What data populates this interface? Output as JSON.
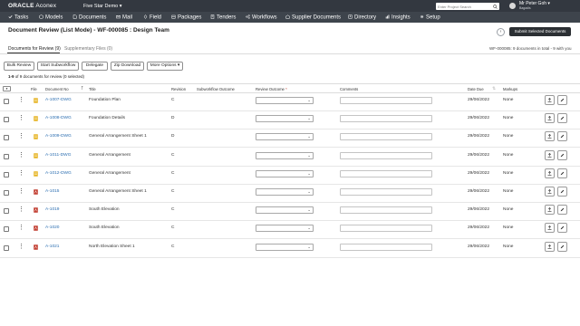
{
  "header": {
    "brand_main": "ORACLE",
    "brand_sub": "Aconex",
    "project": "Five Star Demo",
    "search_placeholder": "Enter Project Search",
    "user_name": "Mr Peter Goh",
    "user_org": "Bagadis"
  },
  "nav": [
    {
      "label": "Tasks",
      "icon": "check-icon"
    },
    {
      "label": "Models",
      "icon": "cube-icon"
    },
    {
      "label": "Documents",
      "icon": "document-icon"
    },
    {
      "label": "Mail",
      "icon": "mail-icon"
    },
    {
      "label": "Field",
      "icon": "field-icon"
    },
    {
      "label": "Packages",
      "icon": "package-icon"
    },
    {
      "label": "Tenders",
      "icon": "tender-icon"
    },
    {
      "label": "Workflows",
      "icon": "workflow-icon"
    },
    {
      "label": "Supplier Documents",
      "icon": "supplier-icon"
    },
    {
      "label": "Directory",
      "icon": "directory-icon"
    },
    {
      "label": "Insights",
      "icon": "insights-icon"
    },
    {
      "label": "Setup",
      "icon": "gear-icon"
    }
  ],
  "page": {
    "title": "Document Review (List Mode) - WF-000085 : Design Team",
    "back_icon": "chevron-left-icon",
    "submit_label": "Submit Selected Documents",
    "tab_review": "Documents for Review (9)",
    "tab_supplementary": "Supplementary Files (0)",
    "summary": "WF-000085: 9 documents in total - 9 with you"
  },
  "toolbar": {
    "bulk_review": "Bulk Review",
    "start_subworkflow": "Start Subworkflow",
    "delegate": "Delegate",
    "zip_download": "Zip Download",
    "more_options": "More Options"
  },
  "count": {
    "range": "1-9",
    "text": " of 9  documents for review  (0 selected)"
  },
  "columns": {
    "file": "File",
    "document_no": "Document No",
    "title": "Title",
    "revision": "Revision",
    "subworkflow_outcome": "Subworkflow Outcome",
    "review_outcome": "Review Outcome",
    "required_mark": "*",
    "comments": "Comments",
    "date_due": "Date Due",
    "markups": "Markups"
  },
  "colors": {
    "header_bg": "#333840",
    "nav_bg": "#3e444c",
    "link": "#2a6db0",
    "required": "#c0392b",
    "dwg_icon": "#e6b422",
    "pdf_icon": "#c0392b"
  },
  "rows": [
    {
      "file": "dwg",
      "doc_no": "A-1007-DWG",
      "title": "Foundation Plan",
      "revision": "C",
      "date_due": "29/06/2022",
      "markups": "None"
    },
    {
      "file": "dwg",
      "doc_no": "A-1008-DWG",
      "title": "Foundation Details",
      "revision": "D",
      "date_due": "29/06/2022",
      "markups": "None"
    },
    {
      "file": "dwg",
      "doc_no": "A-1009-DWG",
      "title": "General Arrangement Sheet 1",
      "revision": "D",
      "date_due": "29/06/2022",
      "markups": "None"
    },
    {
      "file": "dwg",
      "doc_no": "A-1011-DWG",
      "title": "General Arrangement",
      "revision": "C",
      "date_due": "29/06/2022",
      "markups": "None"
    },
    {
      "file": "dwg",
      "doc_no": "A-1012-DWG",
      "title": "General Arrangement",
      "revision": "C",
      "date_due": "29/06/2022",
      "markups": "None"
    },
    {
      "file": "pdf",
      "doc_no": "A-1015",
      "title": "General Arrangement Sheet 1",
      "revision": "C",
      "date_due": "29/06/2022",
      "markups": "None"
    },
    {
      "file": "pdf",
      "doc_no": "A-1019",
      "title": "South Elevation",
      "revision": "C",
      "date_due": "29/06/2022",
      "markups": "None"
    },
    {
      "file": "pdf",
      "doc_no": "A-1020",
      "title": "South Elevation",
      "revision": "C",
      "date_due": "29/06/2022",
      "markups": "None"
    },
    {
      "file": "pdf",
      "doc_no": "A-1021",
      "title": "North Elevation Sheet 1",
      "revision": "C",
      "date_due": "29/06/2022",
      "markups": "None"
    }
  ]
}
